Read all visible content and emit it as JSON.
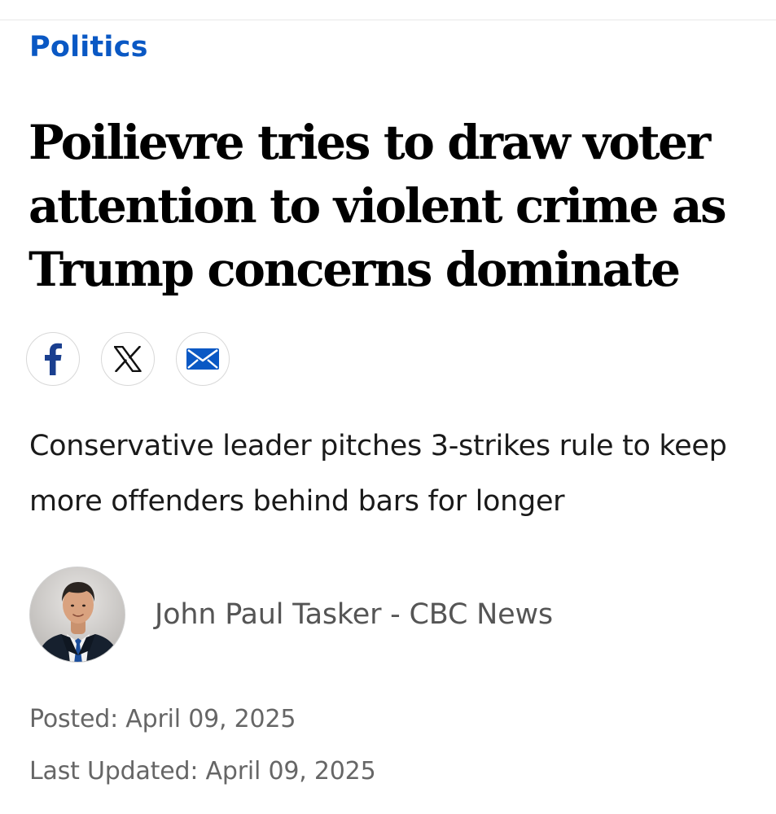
{
  "article": {
    "category": "Politics",
    "headline": "Poilievre tries to draw voter attention to violent crime as Trump concerns dominate",
    "dek": "Conservative leader pitches 3-strikes rule to keep more offenders behind bars for longer",
    "author": "John Paul Tasker - CBC News",
    "posted": "Posted: April 09, 2025",
    "updated": "Last Updated: April 09, 2025"
  },
  "share": {
    "buttons": [
      {
        "network": "facebook",
        "icon": "facebook-icon"
      },
      {
        "network": "x",
        "icon": "x-icon"
      },
      {
        "network": "email",
        "icon": "email-icon"
      }
    ]
  },
  "colors": {
    "accent": "#0a58c4",
    "facebook": "#1a3f8f",
    "headline": "#000000",
    "meta": "#666666"
  }
}
